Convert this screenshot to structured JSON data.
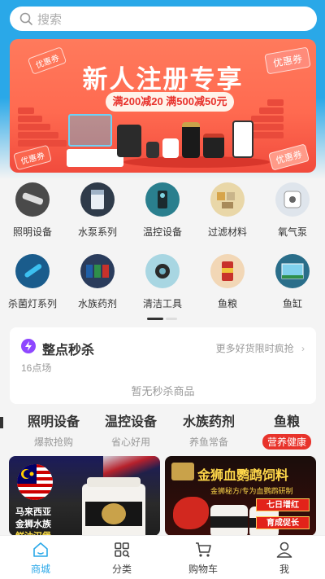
{
  "search": {
    "placeholder": "搜索"
  },
  "banner": {
    "title": "新人注册专享",
    "subtitle": "满200减20 满500减50元",
    "coupon_label": "优惠券"
  },
  "categories": [
    {
      "label": "照明设备",
      "icon": "lighting-icon",
      "color": "#4a4a4a"
    },
    {
      "label": "水泵系列",
      "icon": "water-pump-icon",
      "color": "#2f3b4a"
    },
    {
      "label": "温控设备",
      "icon": "heater-icon",
      "color": "#2a7f8e"
    },
    {
      "label": "过滤材料",
      "icon": "filter-media-icon",
      "color": "#d7b06a"
    },
    {
      "label": "氧气泵",
      "icon": "air-pump-icon",
      "color": "#cfd6e0"
    },
    {
      "label": "杀菌灯系列",
      "icon": "uv-lamp-icon",
      "color": "#1a5c8c"
    },
    {
      "label": "水族药剂",
      "icon": "medicine-icon",
      "color": "#2a3c5c"
    },
    {
      "label": "清洁工具",
      "icon": "cleaning-tool-icon",
      "color": "#6fb2c4"
    },
    {
      "label": "鱼粮",
      "icon": "fish-food-icon",
      "color": "#c8322b"
    },
    {
      "label": "鱼缸",
      "icon": "aquarium-icon",
      "color": "#2a6e8a"
    }
  ],
  "flash_sale": {
    "title": "整点秒杀",
    "more": "更多好货限时疯抢",
    "time": "16点场",
    "empty": "暂无秒杀商品"
  },
  "tabs": [
    {
      "title": "照明设备",
      "sub": "爆款抢购"
    },
    {
      "title": "温控设备",
      "sub": "省心好用"
    },
    {
      "title": "水族药剂",
      "sub": "养鱼常备"
    },
    {
      "title": "鱼粮",
      "sub": "营养健康"
    }
  ],
  "promo_a": {
    "line1": "马来西亚",
    "line2": "金狮水族",
    "line3": "鲜油汉堡"
  },
  "promo_b": {
    "title": "金狮血鹦鹉饲料",
    "sub": "金狮秘方/专为血鹦鹉研制",
    "badge1": "七日增红",
    "badge2": "育成促长"
  },
  "nav": [
    {
      "label": "商城",
      "icon": "home-icon"
    },
    {
      "label": "分类",
      "icon": "category-icon"
    },
    {
      "label": "购物车",
      "icon": "cart-icon"
    },
    {
      "label": "我",
      "icon": "profile-icon"
    }
  ],
  "colors": {
    "accent": "#2aa8e8",
    "red": "#e8332b",
    "flash": "#8e47ff"
  }
}
